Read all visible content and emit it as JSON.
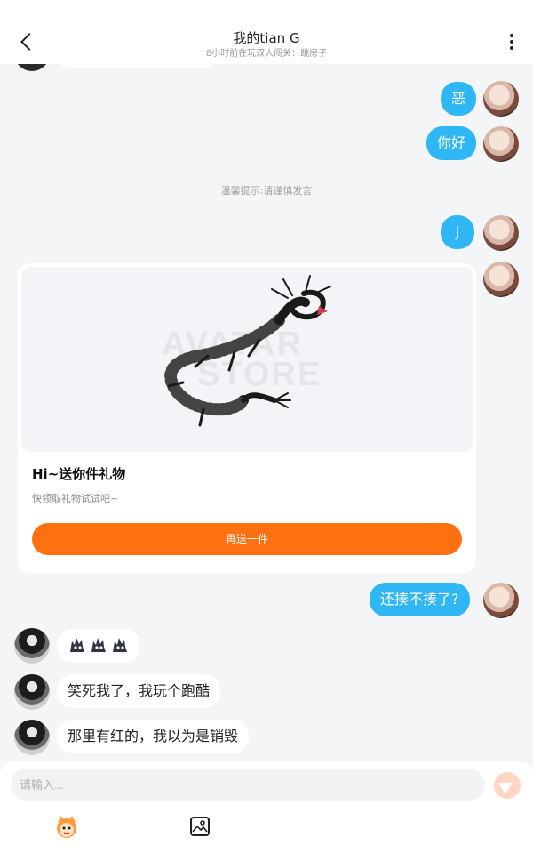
{
  "header": {
    "title": "我的tian G",
    "subtitle": "8小时前在玩双人闯关：跳房子"
  },
  "chat": {
    "system_tip": "温馨提示:请谨慎发言",
    "messages_right_1": "恶",
    "messages_right_2": "你好",
    "messages_right_3": "j",
    "messages_right_4": "还揍不揍了?",
    "messages_left_2": "笑死我了，我玩个跑酷",
    "messages_left_3": "那里有红的，我以为是销毁"
  },
  "gift_card": {
    "title": "Hi~送你件礼物",
    "desc": "快领取礼物试试吧~",
    "button": "再送一件",
    "watermark_line1": "AVATAR",
    "watermark_line2": "STORE"
  },
  "input_bar": {
    "placeholder": "请输入..."
  },
  "colors": {
    "bubble_blue": "#2fb7f5",
    "gift_button": "#ff7010",
    "send_button": "#ffd5c4"
  },
  "icons": {
    "back": "chevron-left-icon",
    "more": "more-vertical-icon",
    "send": "send-icon",
    "emoji": "emoji-face-icon",
    "image": "image-icon",
    "sticker": "spiky-blob-sticker-icon"
  }
}
